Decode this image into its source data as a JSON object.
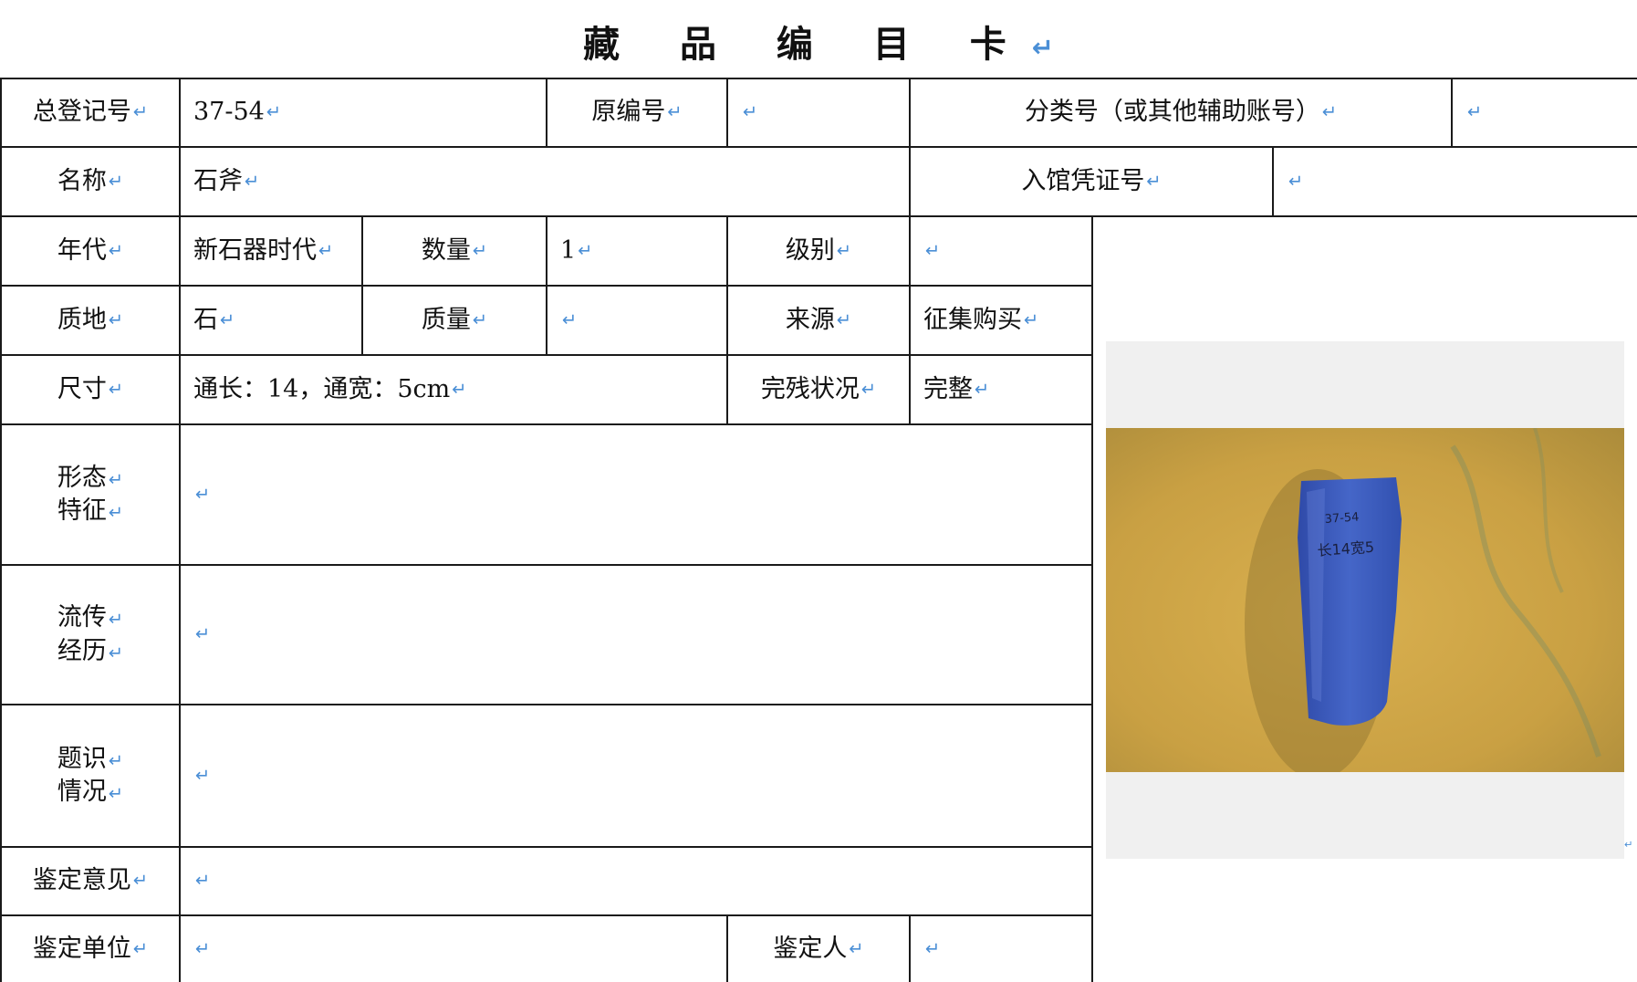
{
  "title": "藏 品 编 目 卡",
  "para_mark": "↵",
  "rows": {
    "r1": {
      "label_reg": "总登记号",
      "value_reg": "37-54",
      "label_orig": "原编号",
      "value_orig": "",
      "label_class": "分类号（或其他辅助账号）",
      "value_class": ""
    },
    "r2": {
      "label_name": "名称",
      "value_name": "石斧",
      "label_entry": "入馆凭证号",
      "value_entry": ""
    },
    "r3": {
      "label_era": "年代",
      "value_era": "新石器时代",
      "label_qty": "数量",
      "value_qty": "1",
      "label_grade": "级别",
      "value_grade": ""
    },
    "r4": {
      "label_mat": "质地",
      "value_mat": "石",
      "label_mass": "质量",
      "value_mass": "",
      "label_src": "来源",
      "value_src": "征集购买"
    },
    "r5": {
      "label_size": "尺寸",
      "value_size": "通长：14，通宽：5cm",
      "label_cond": "完残状况",
      "value_cond": "完整"
    },
    "r6": {
      "label_l1": "形态",
      "label_l2": "特征",
      "value": ""
    },
    "r7": {
      "label_l1": "流传",
      "label_l2": "经历",
      "value": ""
    },
    "r8": {
      "label_l1": "题识",
      "label_l2": "情况",
      "value": ""
    },
    "r9": {
      "label": "鉴定意见",
      "value": ""
    },
    "r10": {
      "label_unit": "鉴定单位",
      "value_unit": "",
      "label_person": "鉴定人",
      "value_person": ""
    }
  },
  "photo": {
    "label_line1": "37-54",
    "label_line2": "长14宽5",
    "colors": {
      "background": "#c9a043",
      "object": "#3a58b8"
    }
  }
}
